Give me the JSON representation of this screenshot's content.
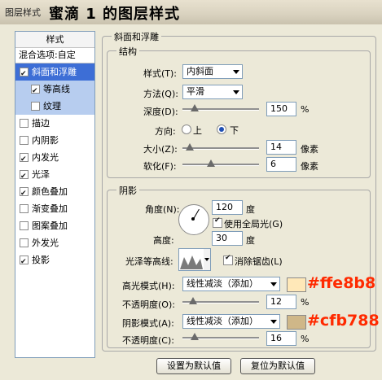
{
  "window": {
    "small_title": "图层样式",
    "big_title": "蜜滴 1 的图层样式"
  },
  "left_panel": {
    "header": "样式",
    "blend_options": "混合选项:自定",
    "items": [
      {
        "label": "斜面和浮雕",
        "checked": true
      },
      {
        "label": "等高线",
        "checked": true
      },
      {
        "label": "纹理",
        "checked": false
      },
      {
        "label": "描边",
        "checked": false
      },
      {
        "label": "内阴影",
        "checked": false
      },
      {
        "label": "内发光",
        "checked": true
      },
      {
        "label": "光泽",
        "checked": true
      },
      {
        "label": "颜色叠加",
        "checked": true
      },
      {
        "label": "渐变叠加",
        "checked": false
      },
      {
        "label": "图案叠加",
        "checked": false
      },
      {
        "label": "外发光",
        "checked": false
      },
      {
        "label": "投影",
        "checked": true
      }
    ]
  },
  "bevel": {
    "section_title": "斜面和浮雕",
    "structure_title": "结构",
    "style_label": "样式(T):",
    "style_value": "内斜面",
    "method_label": "方法(Q):",
    "method_value": "平滑",
    "depth_label": "深度(D):",
    "depth_value": "150",
    "depth_unit": "%",
    "direction_label": "方向:",
    "dir_up": "上",
    "dir_down": "下",
    "size_label": "大小(Z):",
    "size_value": "14",
    "size_unit": "像素",
    "soften_label": "软化(F):",
    "soften_value": "6",
    "soften_unit": "像素"
  },
  "shading": {
    "title": "阴影",
    "angle_label": "角度(N):",
    "angle_value": "120",
    "angle_unit": "度",
    "global_light_label": "使用全局光(G)",
    "altitude_label": "高度:",
    "altitude_value": "30",
    "altitude_unit": "度",
    "gloss_label": "光泽等高线:",
    "antialias_label": "消除锯齿(L)",
    "highlight_mode_label": "高光模式(H):",
    "highlight_mode_value": "线性减淡（添加）",
    "highlight_color": "#ffe8b8",
    "highlight_hex_text": "#ffe8b8",
    "opacity_label_1": "不透明度(O):",
    "opacity_value_1": "12",
    "opacity_unit_1": "%",
    "shadow_mode_label": "阴影模式(A):",
    "shadow_mode_value": "线性减淡（添加）",
    "shadow_color": "#cfb788",
    "shadow_hex_text": "#cfb788",
    "opacity_label_2": "不透明度(C):",
    "opacity_value_2": "16",
    "opacity_unit_2": "%"
  },
  "buttons": {
    "make_default": "设置为默认值",
    "reset_default": "复位为默认值"
  }
}
